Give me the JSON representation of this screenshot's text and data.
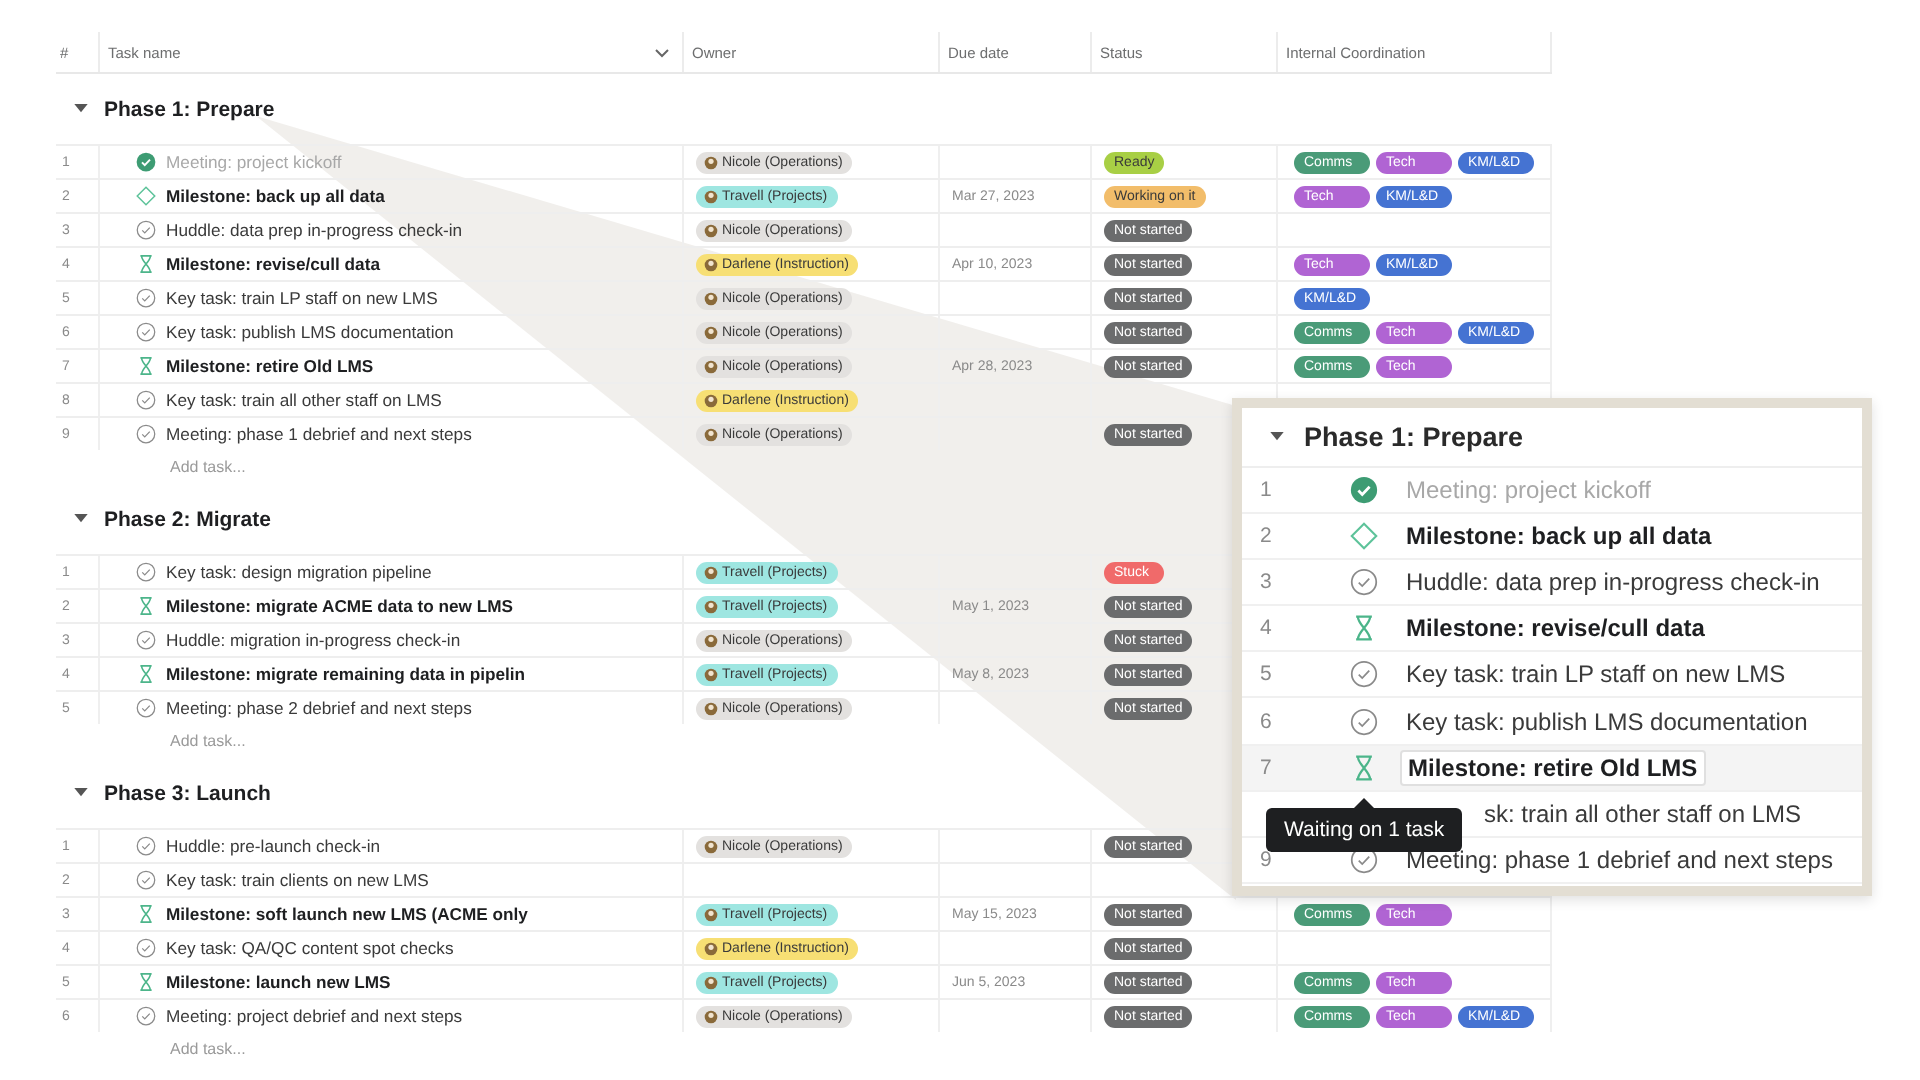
{
  "table": {
    "columns": [
      "#",
      "Task name",
      "Owner",
      "Due date",
      "Status",
      "Internal Coordination"
    ],
    "sections": [
      {
        "title": "Phase 1: Prepare",
        "expanded": true,
        "add_task": "Add task...",
        "rows": [
          {
            "number": "1",
            "kind": "completed",
            "name": "Meeting: project kickoff",
            "owner": {
              "name": "Nicole (Operations)",
              "color": "#e3e1df"
            },
            "status": {
              "label": "Ready",
              "color": "#a8cf45"
            },
            "tags": [
              {
                "label": "Comms",
                "color": "#4a9b78"
              },
              {
                "label": "Tech",
                "color": "#b064d3"
              },
              {
                "label": "KM/L&D",
                "color": "#4573d2"
              }
            ]
          },
          {
            "number": "2",
            "kind": "milestone",
            "name": "Milestone: back up all data",
            "owner": {
              "name": "Travell (Projects)",
              "color": "#9ee6e1"
            },
            "due": "Mar 27, 2023",
            "status": {
              "label": "Working on it",
              "color": "#f2bd6a"
            },
            "tags": [
              {
                "label": "Tech",
                "color": "#b064d3"
              },
              {
                "label": "KM/L&D",
                "color": "#4573d2"
              }
            ]
          },
          {
            "number": "3",
            "kind": "task",
            "name": "Huddle: data prep in-progress check-in",
            "owner": {
              "name": "Nicole (Operations)",
              "color": "#e3e1df"
            },
            "status": {
              "label": "Not started",
              "color": "#6b6c6d"
            },
            "tags": []
          },
          {
            "number": "4",
            "kind": "waiting",
            "name": "Milestone: revise/cull data",
            "owner": {
              "name": "Darlene (Instruction)",
              "color": "#f7df74"
            },
            "due": "Apr 10, 2023",
            "status": {
              "label": "Not started",
              "color": "#6b6c6d"
            },
            "tags": [
              {
                "label": "Tech",
                "color": "#b064d3"
              },
              {
                "label": "KM/L&D",
                "color": "#4573d2"
              }
            ]
          },
          {
            "number": "5",
            "kind": "task",
            "name": "Key task: train LP staff on new LMS",
            "owner": {
              "name": "Nicole (Operations)",
              "color": "#e3e1df"
            },
            "status": {
              "label": "Not started",
              "color": "#6b6c6d"
            },
            "tags": [
              {
                "label": "KM/L&D",
                "color": "#4573d2"
              }
            ]
          },
          {
            "number": "6",
            "kind": "task",
            "name": "Key task: publish LMS documentation",
            "owner": {
              "name": "Nicole (Operations)",
              "color": "#e3e1df"
            },
            "status": {
              "label": "Not started",
              "color": "#6b6c6d"
            },
            "tags": [
              {
                "label": "Comms",
                "color": "#4a9b78"
              },
              {
                "label": "Tech",
                "color": "#b064d3"
              },
              {
                "label": "KM/L&D",
                "color": "#4573d2"
              }
            ]
          },
          {
            "number": "7",
            "kind": "waiting",
            "name": "Milestone: retire Old LMS",
            "owner": {
              "name": "Nicole (Operations)",
              "color": "#e3e1df"
            },
            "due": "Apr 28, 2023",
            "status": {
              "label": "Not started",
              "color": "#6b6c6d"
            },
            "tags": [
              {
                "label": "Comms",
                "color": "#4a9b78"
              },
              {
                "label": "Tech",
                "color": "#b064d3"
              }
            ]
          },
          {
            "number": "8",
            "kind": "task",
            "name": "Key task: train all other staff on LMS",
            "owner": {
              "name": "Darlene (Instruction)",
              "color": "#f7df74"
            },
            "tags": []
          },
          {
            "number": "9",
            "kind": "task",
            "name": "Meeting: phase 1 debrief and next steps",
            "owner": {
              "name": "Nicole (Operations)",
              "color": "#e3e1df"
            },
            "status": {
              "label": "Not started",
              "color": "#6b6c6d"
            },
            "tags": []
          }
        ]
      },
      {
        "title": "Phase 2: Migrate",
        "expanded": true,
        "add_task": "Add task...",
        "rows": [
          {
            "number": "1",
            "kind": "task",
            "name": "Key task: design migration pipeline",
            "owner": {
              "name": "Travell (Projects)",
              "color": "#9ee6e1"
            },
            "status": {
              "label": "Stuck",
              "color": "#f06a6a"
            },
            "tags": []
          },
          {
            "number": "2",
            "kind": "waiting",
            "name": "Milestone: migrate ACME data to new LMS",
            "owner": {
              "name": "Travell (Projects)",
              "color": "#9ee6e1"
            },
            "due": "May 1, 2023",
            "status": {
              "label": "Not started",
              "color": "#6b6c6d"
            },
            "tags": []
          },
          {
            "number": "3",
            "kind": "task",
            "name": "Huddle: migration in-progress check-in",
            "owner": {
              "name": "Nicole (Operations)",
              "color": "#e3e1df"
            },
            "status": {
              "label": "Not started",
              "color": "#6b6c6d"
            },
            "tags": []
          },
          {
            "number": "4",
            "kind": "waiting",
            "name": "Milestone: migrate remaining data in pipelin",
            "owner": {
              "name": "Travell (Projects)",
              "color": "#9ee6e1"
            },
            "due": "May 8, 2023",
            "status": {
              "label": "Not started",
              "color": "#6b6c6d"
            },
            "tags": []
          },
          {
            "number": "5",
            "kind": "task",
            "name": "Meeting: phase 2 debrief and next steps",
            "owner": {
              "name": "Nicole (Operations)",
              "color": "#e3e1df"
            },
            "status": {
              "label": "Not started",
              "color": "#6b6c6d"
            },
            "tags": []
          }
        ]
      },
      {
        "title": "Phase 3: Launch",
        "expanded": true,
        "add_task": "Add task...",
        "rows": [
          {
            "number": "1",
            "kind": "task",
            "name": "Huddle: pre-launch check-in",
            "owner": {
              "name": "Nicole (Operations)",
              "color": "#e3e1df"
            },
            "status": {
              "label": "Not started",
              "color": "#6b6c6d"
            },
            "tags": []
          },
          {
            "number": "2",
            "kind": "task",
            "name": "Key task: train clients on new LMS",
            "tags": []
          },
          {
            "number": "3",
            "kind": "waiting",
            "name": "Milestone: soft launch new LMS (ACME only",
            "owner": {
              "name": "Travell (Projects)",
              "color": "#9ee6e1"
            },
            "due": "May 15, 2023",
            "status": {
              "label": "Not started",
              "color": "#6b6c6d"
            },
            "tags": [
              {
                "label": "Comms",
                "color": "#4a9b78"
              },
              {
                "label": "Tech",
                "color": "#b064d3"
              }
            ]
          },
          {
            "number": "4",
            "kind": "task",
            "name": "Key task: QA/QC content spot checks",
            "owner": {
              "name": "Darlene (Instruction)",
              "color": "#f7df74"
            },
            "status": {
              "label": "Not started",
              "color": "#6b6c6d"
            },
            "tags": []
          },
          {
            "number": "5",
            "kind": "waiting",
            "name": "Milestone: launch new LMS",
            "owner": {
              "name": "Travell (Projects)",
              "color": "#9ee6e1"
            },
            "due": "Jun 5, 2023",
            "status": {
              "label": "Not started",
              "color": "#6b6c6d"
            },
            "tags": [
              {
                "label": "Comms",
                "color": "#4a9b78"
              },
              {
                "label": "Tech",
                "color": "#b064d3"
              }
            ]
          },
          {
            "number": "6",
            "kind": "task",
            "name": "Meeting: project debrief and next steps",
            "owner": {
              "name": "Nicole (Operations)",
              "color": "#e3e1df"
            },
            "status": {
              "label": "Not started",
              "color": "#6b6c6d"
            },
            "tags": [
              {
                "label": "Comms",
                "color": "#4a9b78"
              },
              {
                "label": "Tech",
                "color": "#b064d3"
              },
              {
                "label": "KM/L&D",
                "color": "#4573d2"
              }
            ]
          }
        ]
      }
    ]
  },
  "zoom_inset": {
    "title": "Phase 1: Prepare",
    "expanded": true,
    "rows": [
      {
        "number": "1",
        "kind": "completed",
        "name": "Meeting: project kickoff",
        "focused": false
      },
      {
        "number": "2",
        "kind": "milestone",
        "name": "Milestone: back up all data",
        "focused": false
      },
      {
        "number": "3",
        "kind": "task",
        "name": "Huddle: data prep in-progress check-in",
        "focused": false
      },
      {
        "number": "4",
        "kind": "waiting",
        "name": "Milestone: revise/cull data",
        "focused": false
      },
      {
        "number": "5",
        "kind": "task",
        "name": "Key task: train LP staff on new LMS",
        "focused": false
      },
      {
        "number": "6",
        "kind": "task",
        "name": "Key task: publish LMS documentation",
        "focused": false
      },
      {
        "number": "7",
        "kind": "waiting",
        "name": "Milestone: retire Old LMS",
        "focused": true
      },
      {
        "kind": "covered",
        "name": "sk: train all other staff on LMS",
        "focused": false
      },
      {
        "number": "9",
        "kind": "task",
        "name": "Meeting: phase 1 debrief and next steps",
        "focused": false
      }
    ],
    "tooltip": "Waiting on 1 task"
  }
}
